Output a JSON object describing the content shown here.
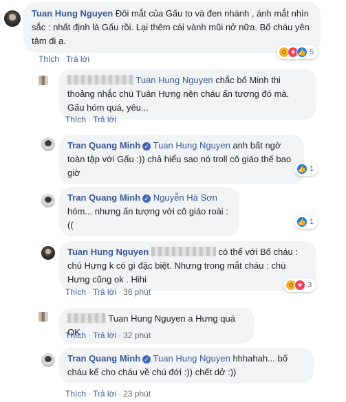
{
  "actions": {
    "like": "Thích",
    "reply": "Trả lời"
  },
  "comments": [
    {
      "author": "Tuan Hung Nguyen",
      "text": "Đôi mắt của Gấu to và đen nhánh , ánh mắt nhìn sắc : nhất định là Gấu rồi. Lại thêm cái vành mũi nở nữa. Bố cháu yên tâm đi ạ.",
      "reaction_count": "5",
      "reactions": [
        "haha",
        "love",
        "like"
      ]
    },
    {
      "author_hidden": true,
      "mention": "Tuan Hung Nguyen",
      "text": "chắc bố Minh thi thoảng nhắc chú Tuân Hưng nên cháu ấn tượng đó mà. Gấu hóm quá, yêu..."
    },
    {
      "author": "Tran Quang Minh",
      "verified": true,
      "mention": "Tuan Hung Nguyen",
      "text": "anh bất ngờ toàn tập với Gấu :)) chả hiểu sao nó troll cô giáo thế bao giờ",
      "reaction_count": "1",
      "reactions": [
        "like"
      ]
    },
    {
      "author": "Tran Quang Minh",
      "verified": true,
      "mention": "Nguyễn Hà Sơn",
      "text": "hóm... nhưng ấn tượng với cô giáo roài :((",
      "reaction_count": "1",
      "reactions": [
        "like"
      ]
    },
    {
      "author": "Tuan Hung Nguyen",
      "mention_hidden": true,
      "text": "có thể với Bố cháu : chú Hưng k có gì đặc biệt. Nhưng trong mắt cháu : chú Hưng cũng ok . Hihi",
      "time": "36 phút",
      "reaction_count": "3",
      "reactions": [
        "haha",
        "love"
      ]
    },
    {
      "author_hidden": true,
      "text": "Tuan Hung Nguyen a Hưng quá OK",
      "time": "32 phút"
    },
    {
      "author": "Tran Quang Minh",
      "verified": true,
      "mention": "Tuan Hung Nguyen",
      "text": "hhhahah... bố cháu kể cho cháu về chú đới :)) chết dở :))",
      "time": "23 phút"
    }
  ],
  "icons": [
    "avatar",
    "verified-badge-icon",
    "haha-reaction-icon",
    "love-reaction-icon",
    "like-reaction-icon"
  ],
  "colors": {
    "link": "#385898",
    "bubble": "#f2f3f5",
    "meta": "#606770",
    "like": "#1877f2",
    "love": "#f33e58",
    "haha": "#f7b125"
  }
}
